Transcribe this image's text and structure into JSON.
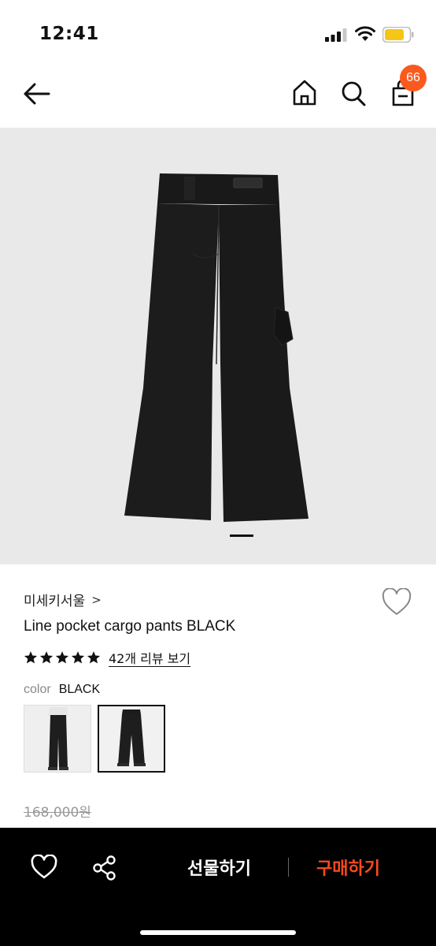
{
  "status_bar": {
    "time": "12:41"
  },
  "nav": {
    "cart_count": "66"
  },
  "product": {
    "brand": "미세키서울",
    "brand_chevron": ">",
    "name": "Line pocket cargo pants BLACK",
    "rating_stars": 5,
    "review_link": "42개 리뷰 보기",
    "color_label": "color",
    "color_value": "BLACK",
    "original_price": "168,000원"
  },
  "bottom_bar": {
    "gift_label": "선물하기",
    "buy_label": "구매하기"
  },
  "colors": {
    "accent": "#fa5a1e",
    "buy": "#fa4a1e",
    "image_bg": "#e9e9e9",
    "bottom_bar": "#000000"
  },
  "icons": [
    "back-arrow-icon",
    "home-icon",
    "search-icon",
    "cart-icon",
    "heart-icon",
    "star-icon",
    "share-icon",
    "signal-icon",
    "wifi-icon",
    "battery-icon"
  ]
}
